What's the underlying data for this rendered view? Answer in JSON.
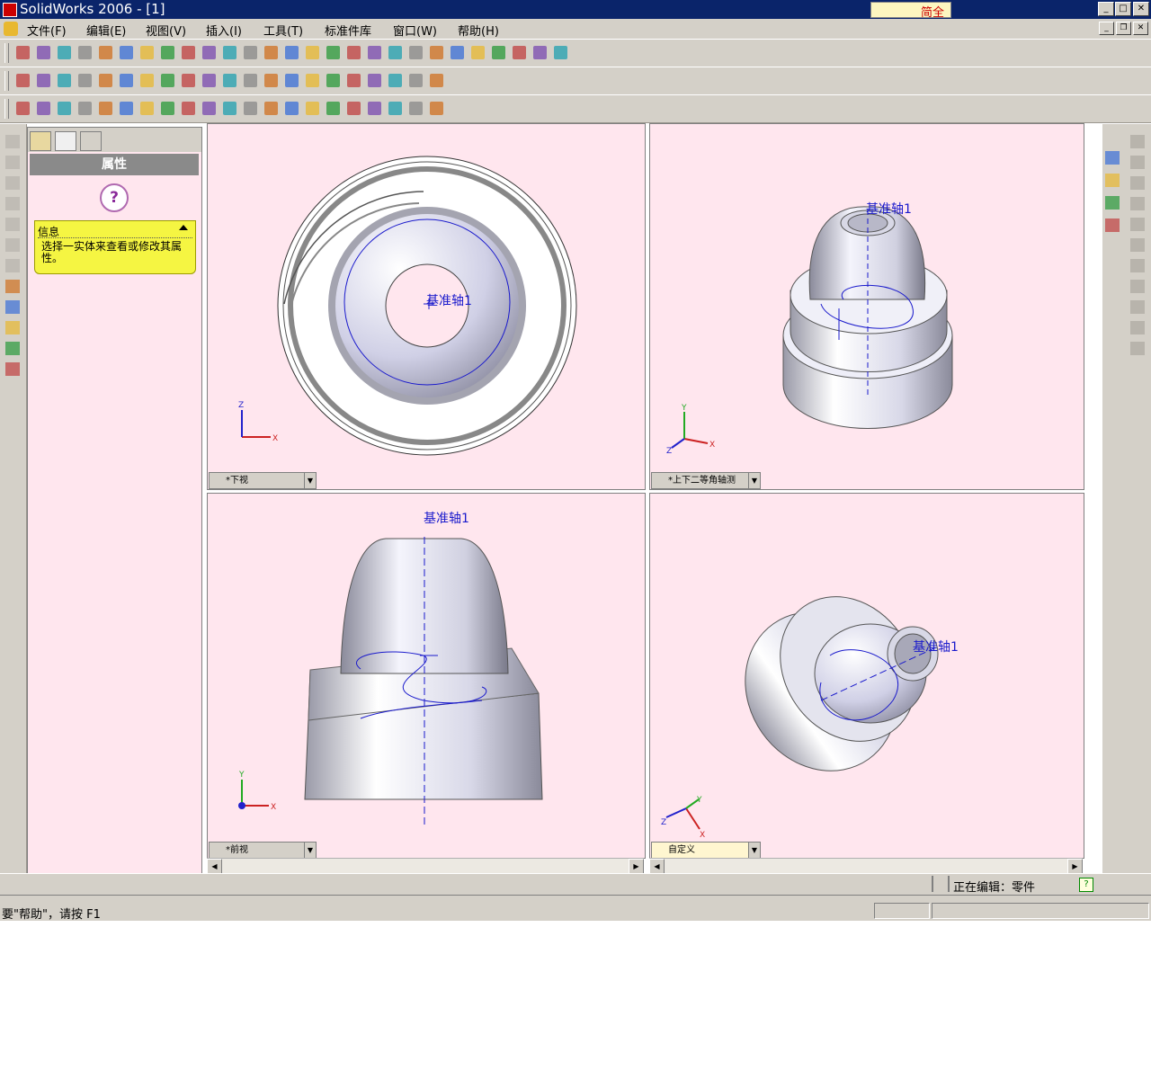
{
  "app": {
    "title": "SolidWorks 2006 - [1]",
    "ime": "简全"
  },
  "menu": [
    {
      "label": "文件(F)"
    },
    {
      "label": "编辑(E)"
    },
    {
      "label": "视图(V)"
    },
    {
      "label": "插入(I)"
    },
    {
      "label": "工具(T)"
    },
    {
      "label": "标准件库"
    },
    {
      "label": "窗口(W)"
    },
    {
      "label": "帮助(H)"
    }
  ],
  "panel": {
    "header": "属性",
    "info_title": "信息",
    "info_message": "选择一实体来查看或修改其属性。"
  },
  "viewports": [
    {
      "view_name": "*下视",
      "axis_label": "基准轴1",
      "triad": [
        "Z",
        "X"
      ]
    },
    {
      "view_name": "*上下二等角轴测",
      "axis_label": "基准轴1",
      "triad": [
        "Y",
        "X",
        "Z"
      ]
    },
    {
      "view_name": "*前视",
      "axis_label": "基准轴1",
      "triad": [
        "Y",
        "X"
      ]
    },
    {
      "view_name": "自定义",
      "axis_label": "基准轴1",
      "triad": [
        "Y",
        "Z",
        "X"
      ]
    }
  ],
  "status": {
    "editing": "正在编辑：零件",
    "help_hint": "要\"帮助\"，请按 F1"
  },
  "colors": {
    "viewport_bg": "#ffe6ee",
    "chrome": "#d4d0c8",
    "titlebar": "#0a246a",
    "info_box": "#f5f542",
    "helix": "#1a1acc"
  }
}
